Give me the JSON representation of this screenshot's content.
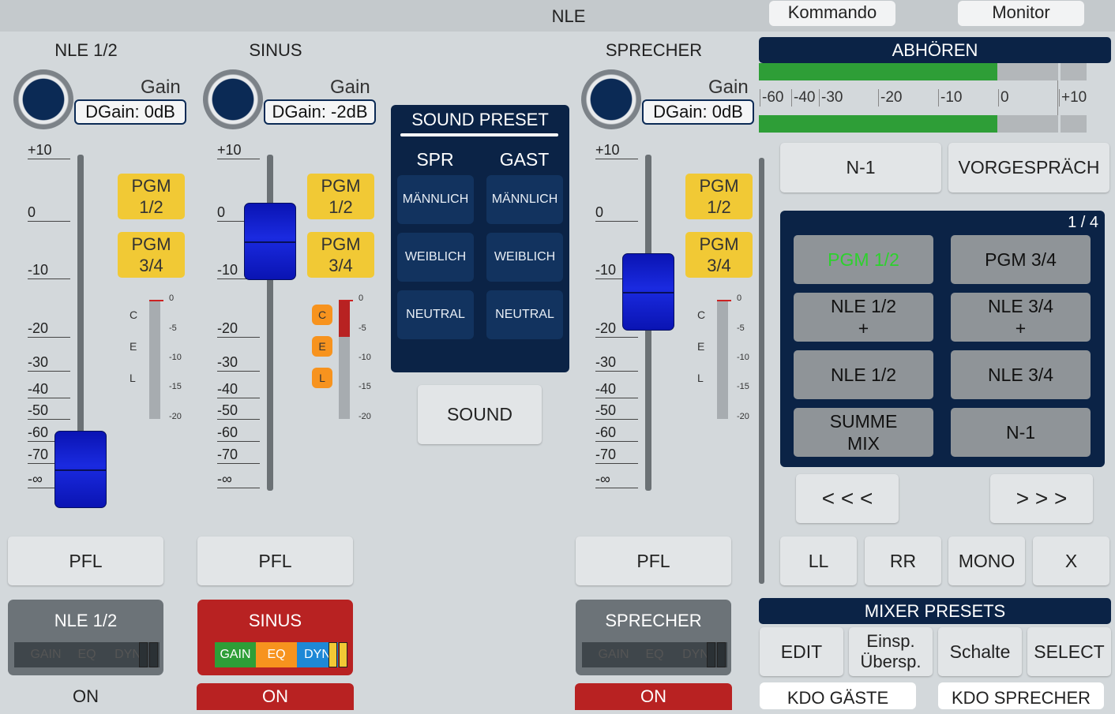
{
  "top": {
    "title": "NLE",
    "kommando": "Kommando",
    "monitor": "Monitor"
  },
  "channels": [
    {
      "name": "NLE 1/2",
      "gain": "Gain",
      "dgain": "DGain: 0dB",
      "pgm1": "PGM\n1/2",
      "pgm2": "PGM\n3/4",
      "pfl": "PFL",
      "box": "NLE 1/2",
      "gain_seg": "GAIN",
      "eq_seg": "EQ",
      "dyn_seg": "DYN",
      "on": "ON",
      "fader_level": 0.06
    },
    {
      "name": "SINUS",
      "gain": "Gain",
      "dgain": "DGain: -2dB",
      "pgm1": "PGM\n1/2",
      "pgm2": "PGM\n3/4",
      "pfl": "PFL",
      "box": "SINUS",
      "gain_seg": "GAIN",
      "eq_seg": "EQ",
      "dyn_seg": "DYN",
      "on": "ON",
      "fader_level": 0.83
    },
    {
      "name": "SPRECHER",
      "gain": "Gain",
      "dgain": "DGain: 0dB",
      "pgm1": "PGM\n1/2",
      "pgm2": "PGM\n3/4",
      "pfl": "PFL",
      "box": "SPRECHER",
      "gain_seg": "GAIN",
      "eq_seg": "EQ",
      "dyn_seg": "DYN",
      "on": "ON",
      "fader_level": 0.66
    }
  ],
  "scale": [
    "+10",
    "0",
    "-10",
    "-20",
    "-30",
    "-40",
    "-50",
    "-60",
    "-70",
    "-∞"
  ],
  "meter_scale": [
    "0",
    "-5",
    "-10",
    "-15",
    "-20"
  ],
  "cel": [
    "C",
    "E",
    "L"
  ],
  "sound_preset": {
    "title": "SOUND PRESET",
    "col1": "SPR",
    "col2": "GAST",
    "rows": [
      "MÄNNLICH",
      "WEIBLICH",
      "NEUTRAL"
    ],
    "sound": "SOUND"
  },
  "monitor": {
    "title": "ABHÖREN",
    "ticks": [
      "-60",
      "-40",
      "-30",
      "-20",
      "-10",
      "0",
      "+10"
    ],
    "n1": "N-1",
    "vorgespraech": "VORGESPRÄCH",
    "page": "1 / 4",
    "grid": [
      "PGM 1/2",
      "PGM 3/4",
      "NLE 1/2\n+",
      "NLE 3/4\n+",
      "NLE 1/2",
      "NLE 3/4",
      "SUMME\nMIX",
      "N-1"
    ],
    "prev": "< < <",
    "next": "> > >",
    "ll": "LL",
    "rr": "RR",
    "mono": "MONO",
    "x": "X",
    "mixer_presets": "MIXER PRESETS",
    "edit": "EDIT",
    "einsp": "Einsp.\nÜbersp.",
    "schalte": "Schalte",
    "select": "SELECT",
    "kdo_gaeste": "KDO GÄSTE",
    "kdo_sprecher": "KDO SPRECHER"
  },
  "colors": {
    "navy": "#0b2346",
    "active_green": "#2dd12d",
    "on_red": "#b82222",
    "pgm_yellow": "#f1c935"
  }
}
